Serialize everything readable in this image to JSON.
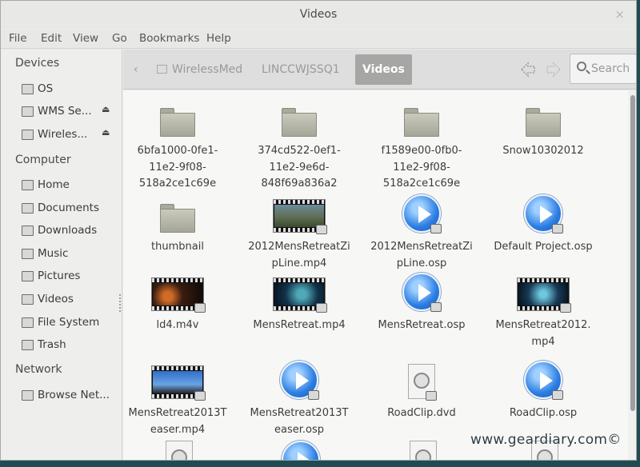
{
  "window": {
    "title": "Videos",
    "close": "×"
  },
  "menu": [
    "File",
    "Edit",
    "View",
    "Go",
    "Bookmarks",
    "Help"
  ],
  "sidebar": {
    "devices_header": "Devices",
    "devices": [
      {
        "label": "OS",
        "icon": "drive-icon"
      },
      {
        "label": "WMS Se...",
        "icon": "network-drive-icon",
        "eject": "⏏"
      },
      {
        "label": "Wireles...",
        "icon": "network-drive-icon",
        "eject": "⏏"
      }
    ],
    "computer_header": "Computer",
    "computer": [
      {
        "label": "Home",
        "icon": "home-icon"
      },
      {
        "label": "Documents",
        "icon": "documents-icon"
      },
      {
        "label": "Downloads",
        "icon": "downloads-icon"
      },
      {
        "label": "Music",
        "icon": "music-icon"
      },
      {
        "label": "Pictures",
        "icon": "pictures-icon"
      },
      {
        "label": "Videos",
        "icon": "videos-icon"
      },
      {
        "label": "File System",
        "icon": "filesystem-icon"
      },
      {
        "label": "Trash",
        "icon": "trash-icon"
      }
    ],
    "network_header": "Network",
    "network": [
      {
        "label": "Browse Net...",
        "icon": "network-icon"
      }
    ]
  },
  "toolbar": {
    "back": "‹",
    "path": [
      "WirelessMed",
      "LINCCWJSSQ1",
      "Videos"
    ],
    "search_label": "Search"
  },
  "files": [
    {
      "name": "6bfa1000-0fe1-11e2-9f08-518a2ce1c69e",
      "type": "folder",
      "lines": [
        "6bfa1000-0fe1-",
        "11e2-9f08-",
        "518a2ce1c69e"
      ]
    },
    {
      "name": "374cd522-0ef1-11e2-9e6d-848f69a836a2",
      "type": "folder",
      "lines": [
        "374cd522-0ef1-",
        "11e2-9e6d-",
        "848f69a836a2"
      ]
    },
    {
      "name": "f1589e00-0fb0-11e2-9f08-518a2ce1c69e",
      "type": "folder",
      "lines": [
        "f1589e00-0fb0-",
        "11e2-9f08-",
        "518a2ce1c69e"
      ]
    },
    {
      "name": "Snow10302012",
      "type": "folder",
      "lines": [
        "Snow10302012"
      ]
    },
    {
      "name": "thumbnail",
      "type": "folder",
      "lines": [
        "thumbnail"
      ]
    },
    {
      "name": "2012MensRetreatZipLine.mp4",
      "type": "video",
      "lines": [
        "2012MensRetreatZi",
        "pLine.mp4"
      ]
    },
    {
      "name": "2012MensRetreatZipLine.osp",
      "type": "osp",
      "lines": [
        "2012MensRetreatZi",
        "pLine.osp"
      ]
    },
    {
      "name": "Default Project.osp",
      "type": "osp",
      "lines": [
        "Default Project.osp"
      ]
    },
    {
      "name": "ld4.m4v",
      "type": "video",
      "lines": [
        "ld4.m4v"
      ]
    },
    {
      "name": "MensRetreat.mp4",
      "type": "video",
      "lines": [
        "MensRetreat.mp4"
      ]
    },
    {
      "name": "MensRetreat.osp",
      "type": "osp",
      "lines": [
        "MensRetreat.osp"
      ]
    },
    {
      "name": "MensRetreat2012.mp4",
      "type": "video",
      "lines": [
        "MensRetreat2012.",
        "mp4"
      ]
    },
    {
      "name": "MensRetreat2013Teaser.mp4",
      "type": "video",
      "lines": [
        "MensRetreat2013T",
        "easer.mp4"
      ]
    },
    {
      "name": "MensRetreat2013Teaser.osp",
      "type": "osp",
      "lines": [
        "MensRetreat2013T",
        "easer.osp"
      ]
    },
    {
      "name": "RoadClip.dvd",
      "type": "dvd",
      "lines": [
        "RoadClip.dvd"
      ]
    },
    {
      "name": "RoadClip.osp",
      "type": "osp",
      "lines": [
        "RoadClip.osp"
      ]
    }
  ],
  "watermark": "www.geardiary.com©",
  "colors": {
    "selected_path": "#a6a6a4",
    "osp_blue": "#2c7ee3",
    "folder": "#b7b8aa"
  }
}
